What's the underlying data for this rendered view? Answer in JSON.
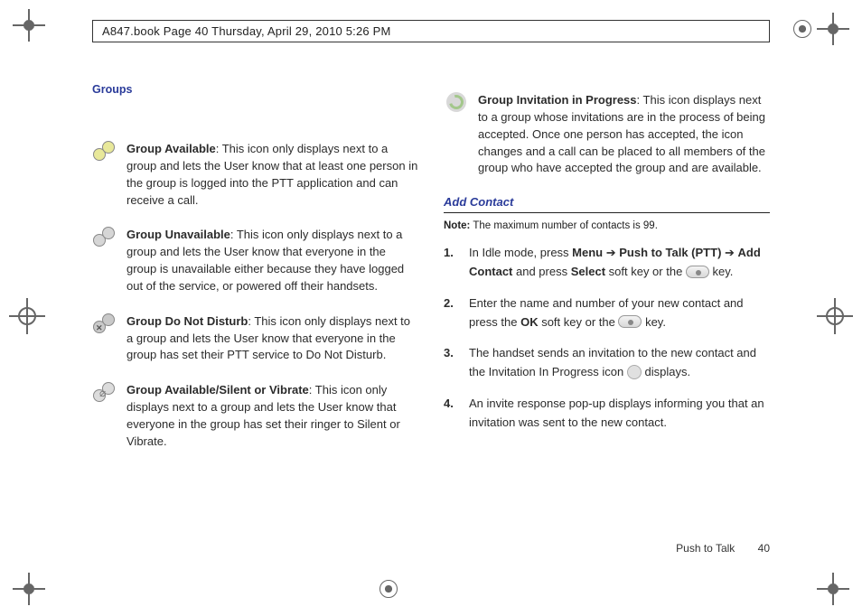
{
  "header": {
    "text": "A847.book  Page 40  Thursday, April 29, 2010  5:26 PM"
  },
  "groups": {
    "heading": "Groups",
    "items": [
      {
        "title": "Group Available",
        "desc": ": This icon only displays next to a group and lets the User know that at least one person in the group is logged into the PTT application and can receive a call."
      },
      {
        "title": "Group Unavailable",
        "desc": ": This icon only displays next to a group and lets the User know that everyone in the group is unavailable either because they have logged out of the service, or powered off their handsets."
      },
      {
        "title": "Group Do Not Disturb",
        "desc": ": This icon only displays next to a group and lets the User know that everyone in the group has set their PTT service to Do Not Disturb."
      },
      {
        "title": "Group Available/Silent or Vibrate",
        "desc": ": This icon only displays next to a group and lets the User know that everyone in the group has set their ringer to Silent or Vibrate."
      },
      {
        "title": "Group Invitation in Progress",
        "desc": ": This icon displays next to a group whose invitations are in the process of being accepted. Once one person has accepted, the icon changes and a call can be placed to all members of the group who have accepted the group and are available."
      }
    ]
  },
  "add_contact": {
    "heading": "Add Contact",
    "note_label": "Note:",
    "note_text": " The maximum number of contacts is 99.",
    "steps": {
      "s1_a": "In Idle mode, press ",
      "s1_b": "Menu",
      "s1_c": "Push to Talk (PTT)",
      "s1_d": "Add Contact",
      "s1_e": " and press ",
      "s1_f": "Select",
      "s1_g": " soft key or the ",
      "s1_h": " key.",
      "s2_a": "Enter the name and number of your new contact and press the ",
      "s2_b": "OK",
      "s2_c": " soft key or the ",
      "s2_d": " key.",
      "s3_a": "The handset sends an invitation to the new contact and the Invitation In Progress icon ",
      "s3_b": " displays.",
      "s4": "An invite response pop-up displays informing you that an invitation was sent to the new contact."
    },
    "arrow": " ➔ "
  },
  "footer": {
    "section": "Push to Talk",
    "page": "40"
  }
}
